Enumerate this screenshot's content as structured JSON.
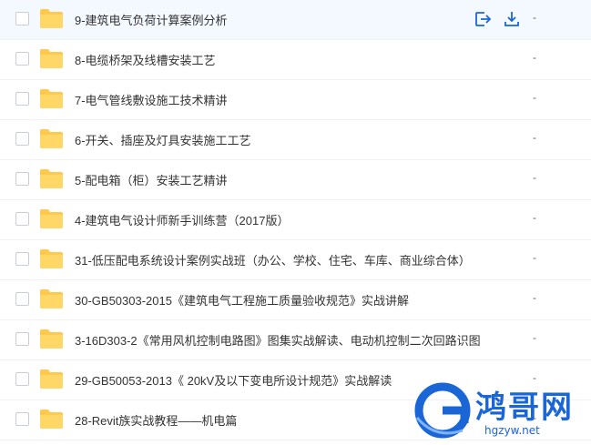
{
  "files": [
    {
      "name": "9-建筑电气负荷计算案例分析",
      "size": "-",
      "hover": true
    },
    {
      "name": "8-电缆桥架及线槽安装工艺",
      "size": "-"
    },
    {
      "name": "7-电气管线敷设施工技术精讲",
      "size": "-"
    },
    {
      "name": "6-开关、插座及灯具安装施工工艺",
      "size": "-"
    },
    {
      "name": "5-配电箱（柜）安装工艺精讲",
      "size": "-"
    },
    {
      "name": "4-建筑电气设计师新手训练营（2017版）",
      "size": "-"
    },
    {
      "name": "31-低压配电系统设计案例实战班（办公、学校、住宅、车库、商业综合体）",
      "size": "-"
    },
    {
      "name": "30-GB50303-2015《建筑电气工程施工质量验收规范》实战讲解",
      "size": "-"
    },
    {
      "name": "3-16D303-2《常用风机控制电路图》图集实战解读、电动机控制二次回路识图",
      "size": "-"
    },
    {
      "name": "29-GB50053-2013《 20kV及以下变电所设计规范》实战解读",
      "size": "-"
    },
    {
      "name": "28-Revit族实战教程——机电篇",
      "size": "-"
    }
  ],
  "row_actions": {
    "share_icon": "share-icon",
    "download_icon": "download-icon"
  },
  "watermark": {
    "text": "鸿哥网",
    "url": "hgzyw.net"
  },
  "colors": {
    "folder": "#ffc94d",
    "accent": "#1a66d6",
    "hover": "#f4f8ff"
  }
}
